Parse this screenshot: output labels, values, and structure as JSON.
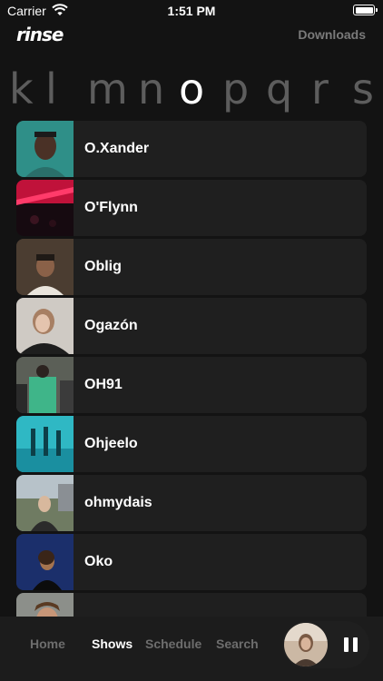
{
  "status": {
    "carrier": "Carrier",
    "time": "1:51 PM"
  },
  "header": {
    "logo": "rinse",
    "downloads": "Downloads"
  },
  "letters": [
    "k",
    "l",
    "m",
    "n",
    "o",
    "p",
    "q",
    "r",
    "s"
  ],
  "active_letter": "o",
  "artists": [
    {
      "name": "O.Xander",
      "photo": "portrait-1"
    },
    {
      "name": "O'Flynn",
      "photo": "red-stage-2"
    },
    {
      "name": "Oblig",
      "photo": "portrait-3"
    },
    {
      "name": "Ogazón",
      "photo": "portrait-4"
    },
    {
      "name": "OH91",
      "photo": "group-5"
    },
    {
      "name": "Ohjeelo",
      "photo": "teal-6"
    },
    {
      "name": "ohmydais",
      "photo": "outdoor-7"
    },
    {
      "name": "Oko",
      "photo": "blue-8"
    },
    {
      "name": "",
      "photo": "portrait-9"
    }
  ],
  "tabs": [
    "Home",
    "Shows",
    "Schedule",
    "Search"
  ],
  "active_tab": "Shows",
  "colors": {
    "background": "#131313",
    "row": "#1f1f1f",
    "tabbar": "#1c1c1c",
    "inactive": "#6d6d6d"
  }
}
